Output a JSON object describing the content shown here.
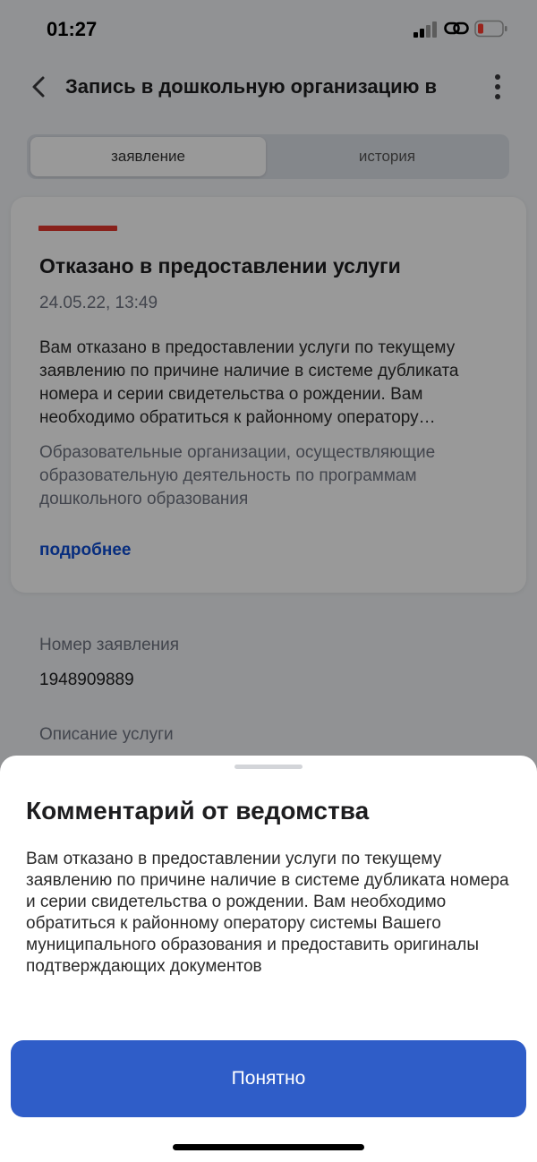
{
  "status_bar": {
    "time": "01:27",
    "icons": [
      "cellular-signal-icon",
      "personal-hotspot-icon",
      "battery-low-icon"
    ],
    "battery_color": "#ff3b30"
  },
  "header": {
    "title": "Запись в дошкольную организацию в",
    "back_icon": "chevron-left-icon",
    "menu_icon": "more-vertical-icon"
  },
  "tabs": [
    {
      "label": "заявление",
      "active": true
    },
    {
      "label": "история",
      "active": false
    }
  ],
  "status_card": {
    "stripe_color": "#e3372e",
    "title": "Отказано в предоставлении услуги",
    "date": "24.05.22, 13:49",
    "text": "Вам отказано в предоставлении услуги по текущему заявлению по причине наличие в системе дубликата номера и серии свидетельства о рождении. Вам необходимо обратиться к районному оператору…",
    "organization": "Образовательные организации, осуществляющие образовательную деятельность по программам дошкольного образования",
    "more_link": "подробнее"
  },
  "details": {
    "application_number_label": "Номер заявления",
    "application_number": "1948909889",
    "service_description_label": "Описание услуги"
  },
  "bottom_sheet": {
    "title": "Комментарий от ведомства",
    "text": "Вам отказано в предоставлении услуги по текущему заявлению по причине наличие в системе дубликата номера и серии свидетельства о рождении. Вам необходимо обратиться к районному оператору системы Вашего муниципального образования и предоставить оригиналы подтверждающих документов",
    "button_label": "Понятно",
    "button_color": "#2f5dc8"
  },
  "colors": {
    "link": "#0d4cd3",
    "secondary_text": "#6e7380"
  }
}
